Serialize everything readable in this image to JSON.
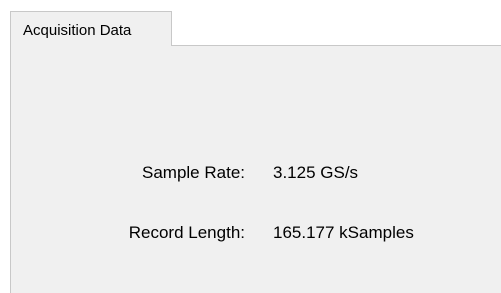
{
  "tabs": [
    {
      "label": "Acquisition Data",
      "active": true
    }
  ],
  "acquisition": {
    "sample_rate": {
      "label": "Sample Rate:",
      "value": "3.125 GS/s"
    },
    "record_length": {
      "label": "Record Length:",
      "value": "165.177 kSamples"
    }
  }
}
